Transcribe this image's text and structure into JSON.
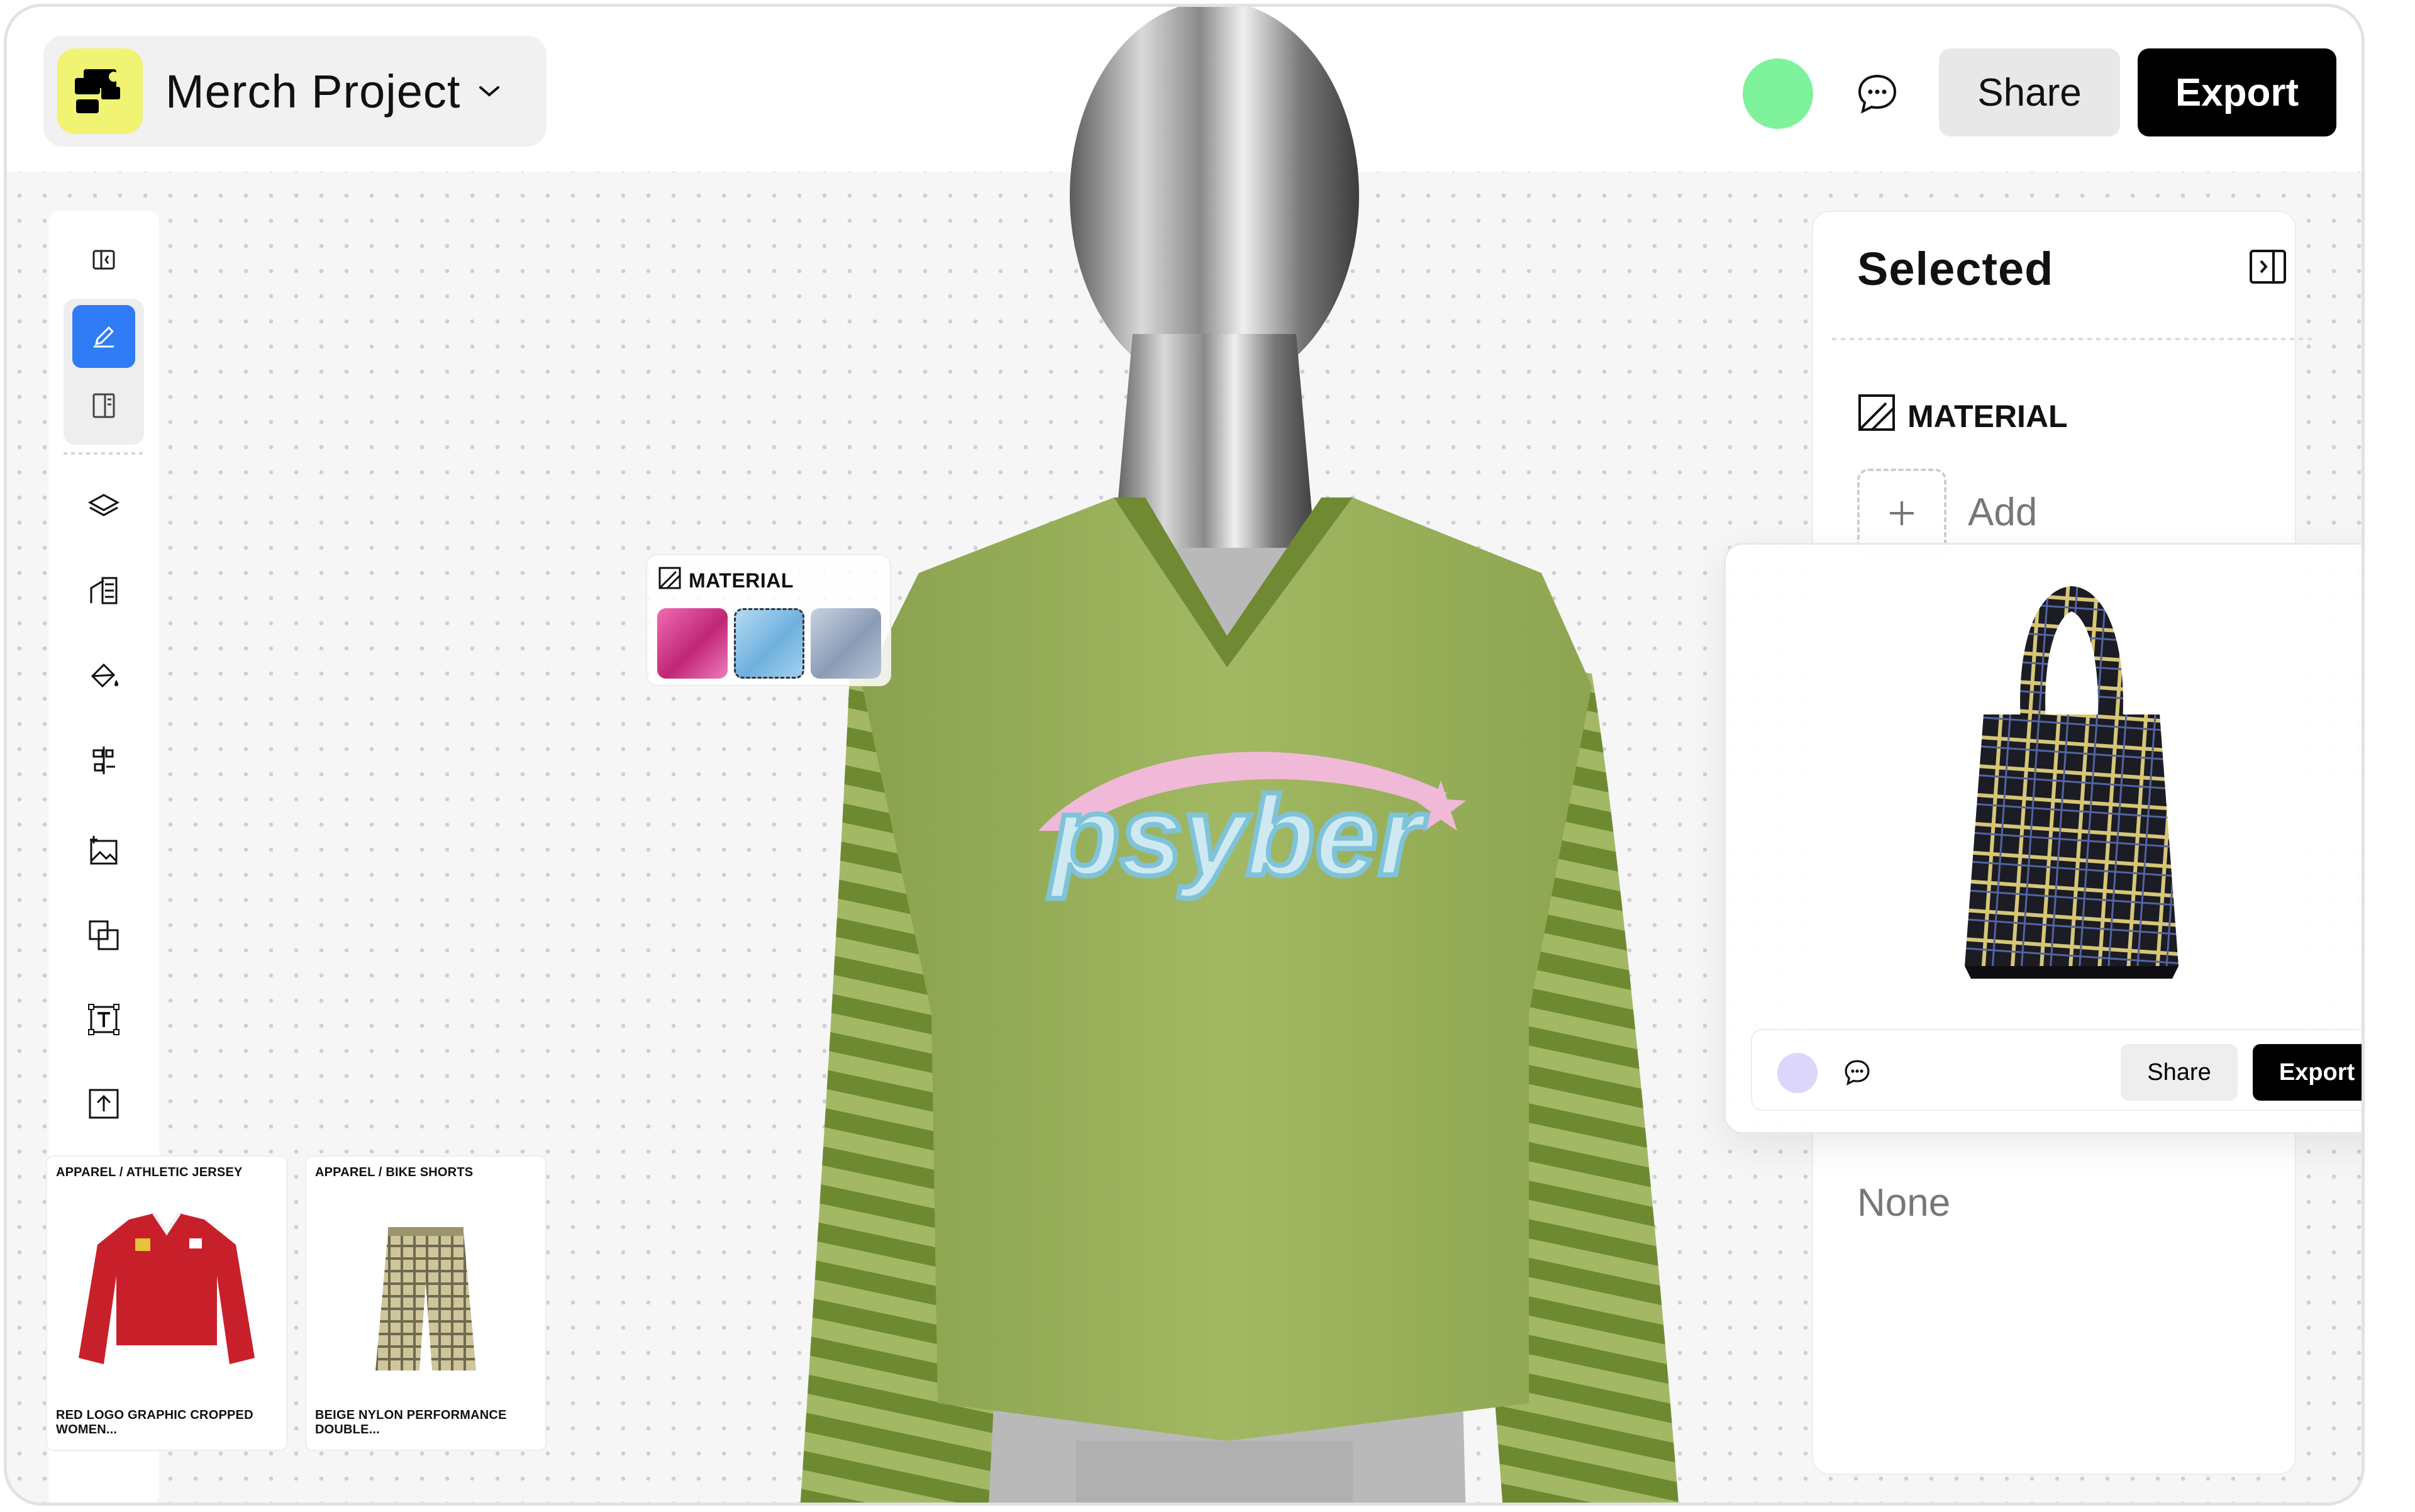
{
  "project": {
    "name": "Merch Project"
  },
  "topbar": {
    "share_label": "Share",
    "export_label": "Export",
    "presence_color": "#7ef29a",
    "logo_color": "#f1f372"
  },
  "toolbar": {
    "tools": [
      "collapse-sidebar",
      "pen",
      "layout",
      "layers",
      "shapes",
      "fill",
      "align",
      "add-image",
      "duplicate",
      "text-frame",
      "upload"
    ],
    "active_tool": "pen",
    "accent": "#2f7cf6"
  },
  "material_popover": {
    "label": "MATERIAL",
    "swatches": [
      "#e0459a",
      "#8ec4ea",
      "#a7b5cb"
    ]
  },
  "garment": {
    "graphic_text": "psyber",
    "body_color": "#9aaf5b",
    "stripe_color": "#6f8a33"
  },
  "cards": [
    {
      "category": "APPAREL / ATHLETIC JERSEY",
      "title": "RED LOGO GRAPHIC CROPPED WOMEN..."
    },
    {
      "category": "APPAREL / BIKE SHORTS",
      "title": "BEIGE NYLON PERFORMANCE DOUBLE..."
    }
  ],
  "right_panel": {
    "title": "Selected",
    "section_label": "MATERIAL",
    "add_label": "Add",
    "none_label": "None"
  },
  "preview": {
    "share_label": "Share",
    "export_label": "Export",
    "presence_color": "#dcd6fb"
  }
}
